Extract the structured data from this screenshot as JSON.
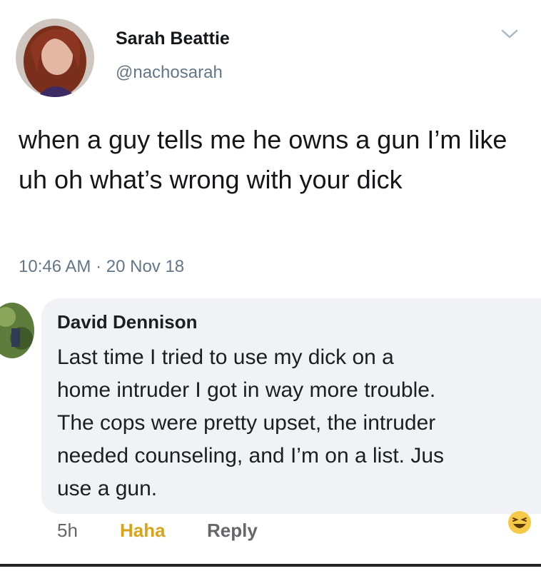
{
  "tweet": {
    "author_name": "Sarah Beattie",
    "author_handle": "@nachosarah",
    "text": "when a guy tells me he owns a gun I’m like uh oh what’s wrong with your dick",
    "time": "10:46 AM",
    "separator": "·",
    "date": "20 Nov 18",
    "menu_icon": "chevron-down-icon"
  },
  "comment": {
    "author_name": "David Dennison",
    "text": "Last time I tried to use my dick on a\nhome intruder I got in way more trouble.\nThe cops were pretty upset, the intruder\nneeded counseling, and I’m on a list. Jus\nuse a gun.",
    "age": "5h",
    "reaction_label": "Haha",
    "reply_label": "Reply",
    "reaction_icon": "laughing-emoji-icon",
    "reaction_color": "#d9a419"
  }
}
